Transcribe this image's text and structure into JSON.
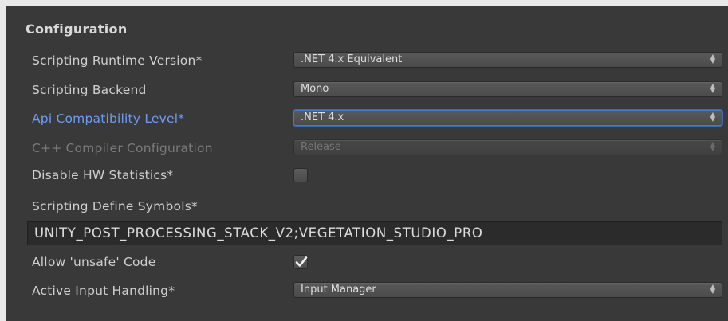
{
  "section": {
    "title": "Configuration"
  },
  "fields": {
    "scripting_runtime": {
      "label": "Scripting Runtime Version*",
      "value": ".NET 4.x Equivalent"
    },
    "scripting_backend": {
      "label": "Scripting Backend",
      "value": "Mono"
    },
    "api_compat": {
      "label": "Api Compatibility Level*",
      "value": ".NET 4.x"
    },
    "cpp_compiler": {
      "label": "C++ Compiler Configuration",
      "value": "Release"
    },
    "disable_hw_stats": {
      "label": "Disable HW Statistics*",
      "checked": false
    },
    "define_symbols": {
      "label": "Scripting Define Symbols*",
      "value": "UNITY_POST_PROCESSING_STACK_V2;VEGETATION_STUDIO_PRO"
    },
    "allow_unsafe": {
      "label": "Allow 'unsafe' Code",
      "checked": true
    },
    "input_handling": {
      "label": "Active Input Handling*",
      "value": "Input Manager"
    }
  },
  "icons": {
    "dropdown_arrow": "up-down-arrows-icon",
    "checkmark": "checkmark-icon"
  },
  "colors": {
    "panel_background": "#393939",
    "outer_background": "#e9e9e9",
    "active_label": "#6b9cf2",
    "focus_border": "#4a78c9",
    "text": "#cfcfcf",
    "disabled_text": "#7a7a7a"
  }
}
